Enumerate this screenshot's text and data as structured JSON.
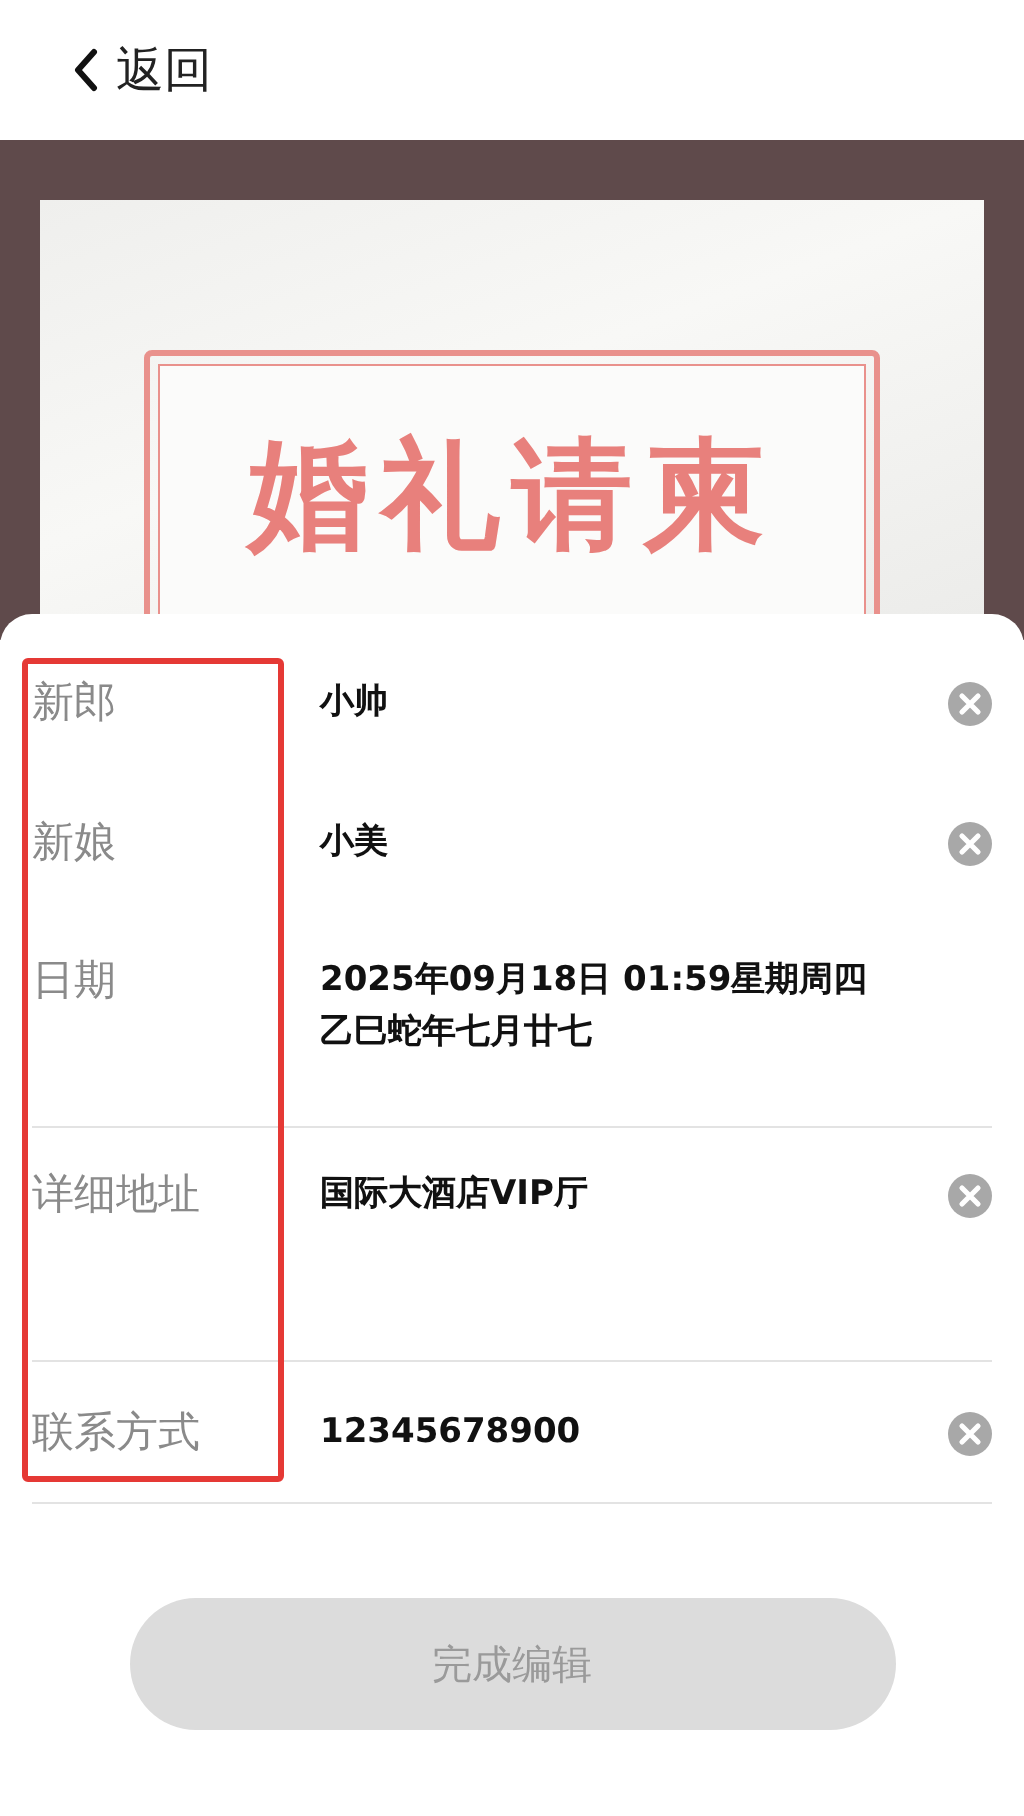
{
  "header": {
    "back_label": "返回"
  },
  "invitation": {
    "title": "婚礼请柬"
  },
  "form": {
    "labels_highlighted": true,
    "rows": [
      {
        "label": "新郎",
        "value": "小帅",
        "clearable": true,
        "divider": false
      },
      {
        "label": "新娘",
        "value": "小美",
        "clearable": true,
        "divider": false
      },
      {
        "label": "日期",
        "value": "2025年09月18日 01:59星期周四",
        "value_line_2": "乙巳蛇年七月廿七",
        "clearable": false,
        "divider": true
      },
      {
        "label": "详细地址",
        "value": "国际大酒店VIP厅",
        "clearable": true,
        "divider": true
      },
      {
        "label": "联系方式",
        "value": "12345678900",
        "clearable": true,
        "divider": true
      }
    ]
  },
  "submit": {
    "label": "完成编辑",
    "disabled": true
  }
}
